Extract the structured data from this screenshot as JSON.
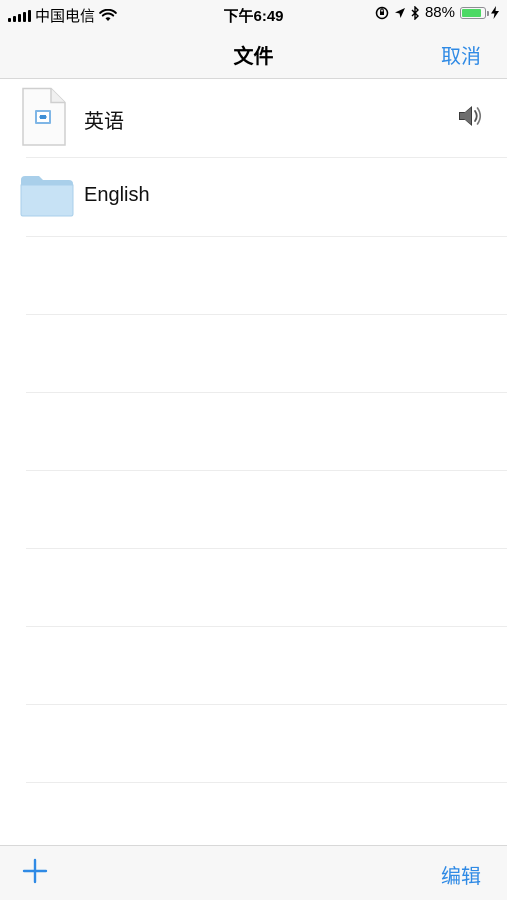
{
  "status_bar": {
    "carrier": "中国电信",
    "time": "下午6:49",
    "battery_percent": "88%",
    "battery_level": 0.88
  },
  "nav": {
    "title": "文件",
    "cancel_label": "取消"
  },
  "files": [
    {
      "name": "英语",
      "type": "audio-document",
      "icon": "document-icon",
      "badge": "speaker-icon"
    },
    {
      "name": "English",
      "type": "folder",
      "icon": "folder-icon"
    }
  ],
  "toolbar": {
    "add_icon": "plus-icon",
    "edit_label": "编辑"
  },
  "colors": {
    "accent": "#2f8ae5",
    "folder": "#c7e2f5",
    "battery": "#4cd964"
  }
}
